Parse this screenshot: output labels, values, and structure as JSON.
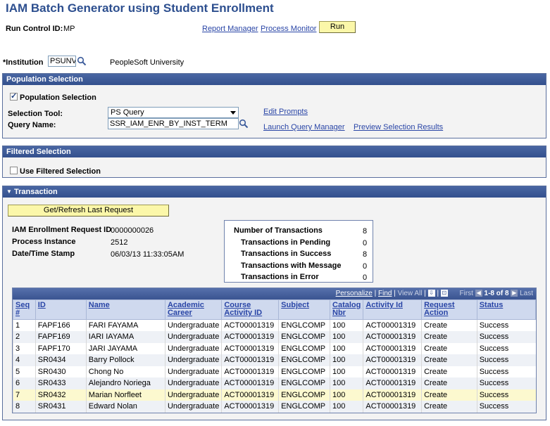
{
  "page": {
    "title": "IAM Batch Generator using Student Enrollment",
    "run_control_label": "Run Control ID:",
    "run_control_value": "MP",
    "report_manager": "Report Manager",
    "process_monitor": "Process Monitor",
    "run_button": "Run",
    "institution_label": "*Institution",
    "institution_value": "PSUNV",
    "institution_desc": "PeopleSoft University"
  },
  "population": {
    "header": "Population Selection",
    "checkbox_label": "Population Selection",
    "checked": true,
    "selection_tool_label": "Selection Tool:",
    "selection_tool_value": "PS Query",
    "query_name_label": "Query Name:",
    "query_name_value": "SSR_IAM_ENR_BY_INST_TERM",
    "edit_prompts": "Edit Prompts",
    "launch_query_manager": "Launch Query Manager",
    "preview_results": "Preview Selection Results"
  },
  "filtered": {
    "header": "Filtered Selection",
    "checkbox_label": "Use Filtered Selection",
    "checked": false
  },
  "transaction": {
    "header": "Transaction",
    "toggle_glyph": "▼",
    "refresh_button": "Get/Refresh Last Request",
    "info": [
      {
        "label": "IAM Enrollment Request ID",
        "value": "0000000026"
      },
      {
        "label": "Process Instance",
        "value": "2512"
      },
      {
        "label": "Date/Time Stamp",
        "value": "06/03/13 11:33:05AM"
      }
    ],
    "counts": [
      {
        "label": "Number of Transactions",
        "value": "8"
      },
      {
        "label": "Transactions in Pending",
        "value": "0"
      },
      {
        "label": "Transactions in Success",
        "value": "8"
      },
      {
        "label": "Transactions with Message",
        "value": "0"
      },
      {
        "label": "Transactions in Error",
        "value": "0"
      }
    ]
  },
  "grid": {
    "personalize": "Personalize",
    "find": "Find",
    "view_all": "View All",
    "first": "First",
    "range": "1-8 of 8",
    "last": "Last",
    "columns": [
      "Seq #",
      "ID",
      "Name",
      "Academic Career",
      "Course Activity ID",
      "Subject",
      "Catalog Nbr",
      "Activity Id",
      "Request Action",
      "Status"
    ],
    "rows": [
      [
        "1",
        "FAPF166",
        "FARI FAYAMA",
        "Undergraduate",
        "ACT00001319",
        "ENGLCOMP",
        "100",
        "ACT00001319",
        "Create",
        "Success"
      ],
      [
        "2",
        "FAPF169",
        "IARI IAYAMA",
        "Undergraduate",
        "ACT00001319",
        "ENGLCOMP",
        "100",
        "ACT00001319",
        "Create",
        "Success"
      ],
      [
        "3",
        "FAPF170",
        "JARI JAYAMA",
        "Undergraduate",
        "ACT00001319",
        "ENGLCOMP",
        "100",
        "ACT00001319",
        "Create",
        "Success"
      ],
      [
        "4",
        "SR0434",
        "Barry Pollock",
        "Undergraduate",
        "ACT00001319",
        "ENGLCOMP",
        "100",
        "ACT00001319",
        "Create",
        "Success"
      ],
      [
        "5",
        "SR0430",
        "Chong No",
        "Undergraduate",
        "ACT00001319",
        "ENGLCOMP",
        "100",
        "ACT00001319",
        "Create",
        "Success"
      ],
      [
        "6",
        "SR0433",
        "Alejandro Noriega",
        "Undergraduate",
        "ACT00001319",
        "ENGLCOMP",
        "100",
        "ACT00001319",
        "Create",
        "Success"
      ],
      [
        "7",
        "SR0432",
        "Marian Norfleet",
        "Undergraduate",
        "ACT00001319",
        "ENGLCOMP",
        "100",
        "ACT00001319",
        "Create",
        "Success"
      ],
      [
        "8",
        "SR0431",
        "Edward Nolan",
        "Undergraduate",
        "ACT00001319",
        "ENGLCOMP",
        "100",
        "ACT00001319",
        "Create",
        "Success"
      ]
    ]
  }
}
